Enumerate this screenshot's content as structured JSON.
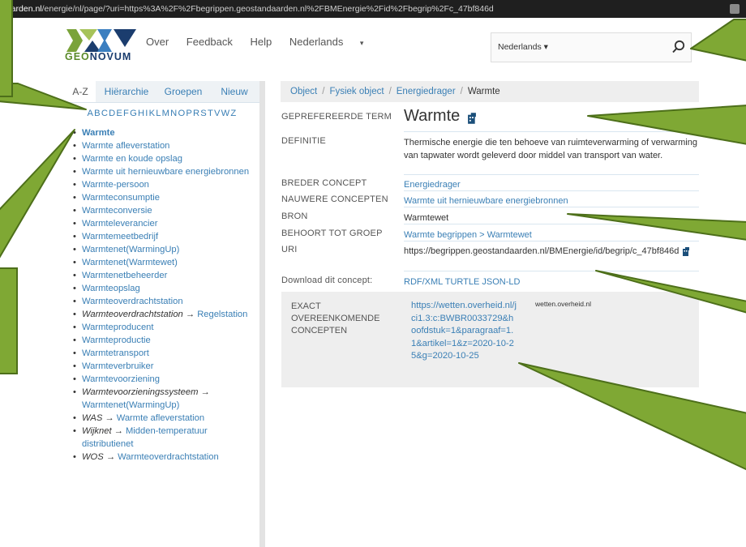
{
  "browser": {
    "url_host": "daarden.nl",
    "url_path": "/energie/nl/page/?uri=https%3A%2F%2Fbegrippen.geostandaarden.nl%2FBMEnergie%2Fid%2Fbegrip%2Fc_47bf846d"
  },
  "header": {
    "logo_text_part1": "GEO",
    "logo_text_part2": "NOVUM",
    "nav": [
      "Over",
      "Feedback",
      "Help",
      "Nederlands"
    ],
    "lang_button": "Nederlands",
    "search_placeholder": ""
  },
  "sidebar": {
    "tabs": [
      "A-Z",
      "Hiërarchie",
      "Groepen",
      "Nieuw"
    ],
    "alphabet": "ABCDEFGHIKLMNOPRSTVWZ",
    "terms": [
      {
        "kind": "current",
        "label": "Warmte"
      },
      {
        "kind": "link",
        "label": "Warmte afleverstation"
      },
      {
        "kind": "link",
        "label": "Warmte en koude opslag"
      },
      {
        "kind": "link",
        "label": "Warmte uit hernieuwbare energiebronnen"
      },
      {
        "kind": "link",
        "label": "Warmte-persoon"
      },
      {
        "kind": "link",
        "label": "Warmteconsumptie"
      },
      {
        "kind": "link",
        "label": "Warmteconversie"
      },
      {
        "kind": "link",
        "label": "Warmteleverancier"
      },
      {
        "kind": "link",
        "label": "Warmtemeetbedrijf"
      },
      {
        "kind": "link",
        "label": "Warmtenet(WarmingUp)"
      },
      {
        "kind": "link",
        "label": "Warmtenet(Warmtewet)"
      },
      {
        "kind": "link",
        "label": "Warmtenetbeheerder"
      },
      {
        "kind": "link",
        "label": "Warmteopslag"
      },
      {
        "kind": "link",
        "label": "Warmteoverdrachtstation"
      },
      {
        "kind": "redirect",
        "label": "Warmteoverdrachtstation",
        "target": "Regelstation"
      },
      {
        "kind": "link",
        "label": "Warmteproducent"
      },
      {
        "kind": "link",
        "label": "Warmteproductie"
      },
      {
        "kind": "link",
        "label": "Warmtetransport"
      },
      {
        "kind": "link",
        "label": "Warmteverbruiker"
      },
      {
        "kind": "link",
        "label": "Warmtevoorziening"
      },
      {
        "kind": "redirect",
        "label": "Warmtevoorzieningssysteem",
        "target": "Warmtenet(WarmingUp)"
      },
      {
        "kind": "redirect",
        "label": "WAS",
        "target": "Warmte afleverstation"
      },
      {
        "kind": "redirect",
        "label": "Wijknet",
        "target": "Midden-temperatuur distributienet"
      },
      {
        "kind": "redirect",
        "label": "WOS",
        "target": "Warmteoverdrachtstation"
      }
    ]
  },
  "breadcrumb": [
    "Object",
    "Fysiek object",
    "Energiedrager",
    "Warmte"
  ],
  "concept": {
    "preferred_label_caption": "GEPREFEREERDE TERM",
    "preferred_term": "Warmte",
    "definition_caption": "DEFINITIE",
    "definition": "Thermische energie die ten behoeve van ruimteverwarming of verwarming van tapwater wordt geleverd door middel van transport van water.",
    "broader_caption": "BREDER CONCEPT",
    "broader": "Energiedrager",
    "narrower_caption": "NAUWERE CONCEPTEN",
    "narrower": "Warmte uit hernieuwbare energiebronnen",
    "source_caption": "BRON",
    "source": "Warmtewet",
    "group_caption": "BEHOORT TOT GROEP",
    "group_path": "Warmte begrippen > Warmtewet",
    "uri_caption": "URI",
    "uri": "https://begrippen.geostandaarden.nl/BMEnergie/id/begrip/c_47bf846d",
    "download_caption": "Download dit concept:",
    "download_formats": "RDF/XML TURTLE JSON-LD",
    "exact_caption": "EXACT OVEREENKOMENDE CONCEPTEN",
    "exact_link": "https://wetten.overheid.nl/jci1.3:c:BWBR0033729&hoofdstuk=1&paragraaf=1.1&artikel=1&z=2020-10-25&g=2020-10-25",
    "exact_source": "wetten.overheid.nl"
  },
  "colors": {
    "link": "#3a7fb5",
    "callout_green": "#7fa834",
    "callout_border": "#4d6f1a"
  }
}
